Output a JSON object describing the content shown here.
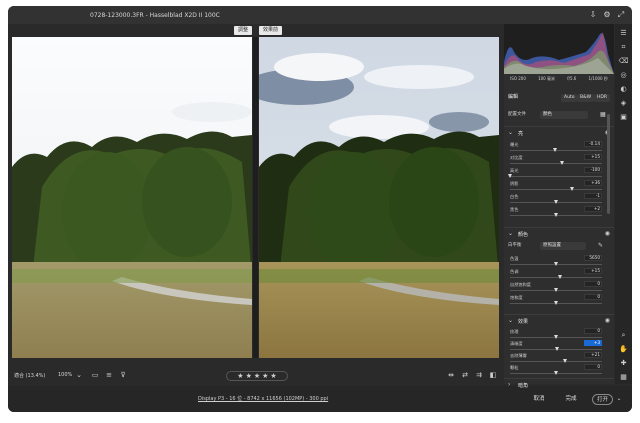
{
  "window": {
    "title": "0728-123000.3FR  -  Hasselblad X2D II 100C"
  },
  "view": {
    "before_label": "調整",
    "after_label": "效果前"
  },
  "bottombar": {
    "fit_label": "適合 (13.4%)",
    "zoom_label": "100%",
    "rating_stars": [
      "★",
      "★",
      "★",
      "★",
      "★"
    ]
  },
  "footer": {
    "info": "Display P3 - 16 位 - 8742 x 11656 (102MP) - 300 ppi",
    "cancel_label": "取消",
    "done_label": "完成",
    "open_label": "打开"
  },
  "panel": {
    "camera": {
      "iso": "ISO 200",
      "focal": "100 毫米",
      "aperture": "f/5.6",
      "shutter": "1/1000 秒"
    },
    "edit_title": "編輯",
    "profile_buttons": [
      "Auto",
      "B&W",
      "HDR"
    ],
    "profile_label": "配置文件",
    "profile_value": "顏色",
    "sections": {
      "light": "亮",
      "color": "顏色",
      "effects": "效果",
      "next": "暗角"
    },
    "light_sliders": [
      {
        "label": "曝光",
        "value": "-0.14",
        "pos": 0.49
      },
      {
        "label": "对比度",
        "value": "+15",
        "pos": 0.57
      },
      {
        "label": "高光",
        "value": "-100",
        "pos": 0.0
      },
      {
        "label": "阴影",
        "value": "+36",
        "pos": 0.68
      },
      {
        "label": "白色",
        "value": "-1",
        "pos": 0.5
      },
      {
        "label": "黑色",
        "value": "+2",
        "pos": 0.51
      }
    ],
    "wb_label": "白平衡",
    "wb_value": "原照設置",
    "color_sliders": [
      {
        "label": "色温",
        "value": "5650",
        "pos": 0.5
      },
      {
        "label": "色调",
        "value": "+15",
        "pos": 0.55
      },
      {
        "label": "自然饱和度",
        "value": "0",
        "pos": 0.5
      },
      {
        "label": "饱和度",
        "value": "0",
        "pos": 0.5
      }
    ],
    "effect_sliders": [
      {
        "label": "纹理",
        "value": "0",
        "pos": 0.5
      },
      {
        "label": "清晰度",
        "value": "+3",
        "pos": 0.52,
        "active": true
      },
      {
        "label": "去除薄雾",
        "value": "+21",
        "pos": 0.6
      },
      {
        "label": "颗粒",
        "value": "0",
        "pos": 0.5
      }
    ]
  },
  "colors": {
    "accent": "#1a6ad6",
    "bg": "#2a2a2a",
    "panel": "#2e2e2e"
  }
}
